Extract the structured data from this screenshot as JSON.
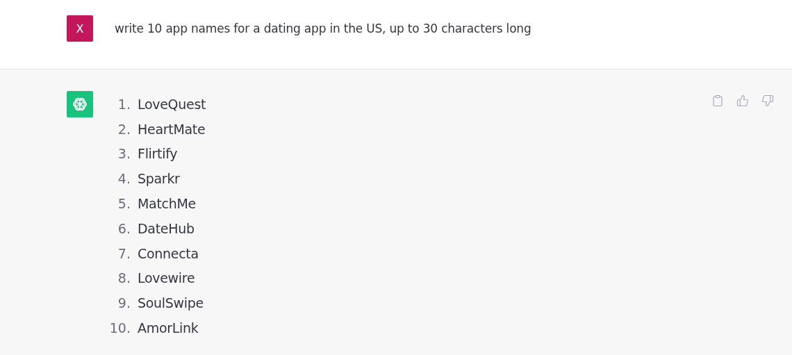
{
  "user_message": {
    "avatar_letter": "X",
    "text": "write 10 app names for a dating app in the US, up to 30 characters long"
  },
  "assistant_message": {
    "items": [
      {
        "number": "1.",
        "name": "LoveQuest"
      },
      {
        "number": "2.",
        "name": "HeartMate"
      },
      {
        "number": "3.",
        "name": "Flirtify"
      },
      {
        "number": "4.",
        "name": "Sparkr"
      },
      {
        "number": "5.",
        "name": "MatchMe"
      },
      {
        "number": "6.",
        "name": "DateHub"
      },
      {
        "number": "7.",
        "name": "Connecta"
      },
      {
        "number": "8.",
        "name": "Lovewire"
      },
      {
        "number": "9.",
        "name": "SoulSwipe"
      },
      {
        "number": "10.",
        "name": "AmorLink"
      }
    ]
  }
}
